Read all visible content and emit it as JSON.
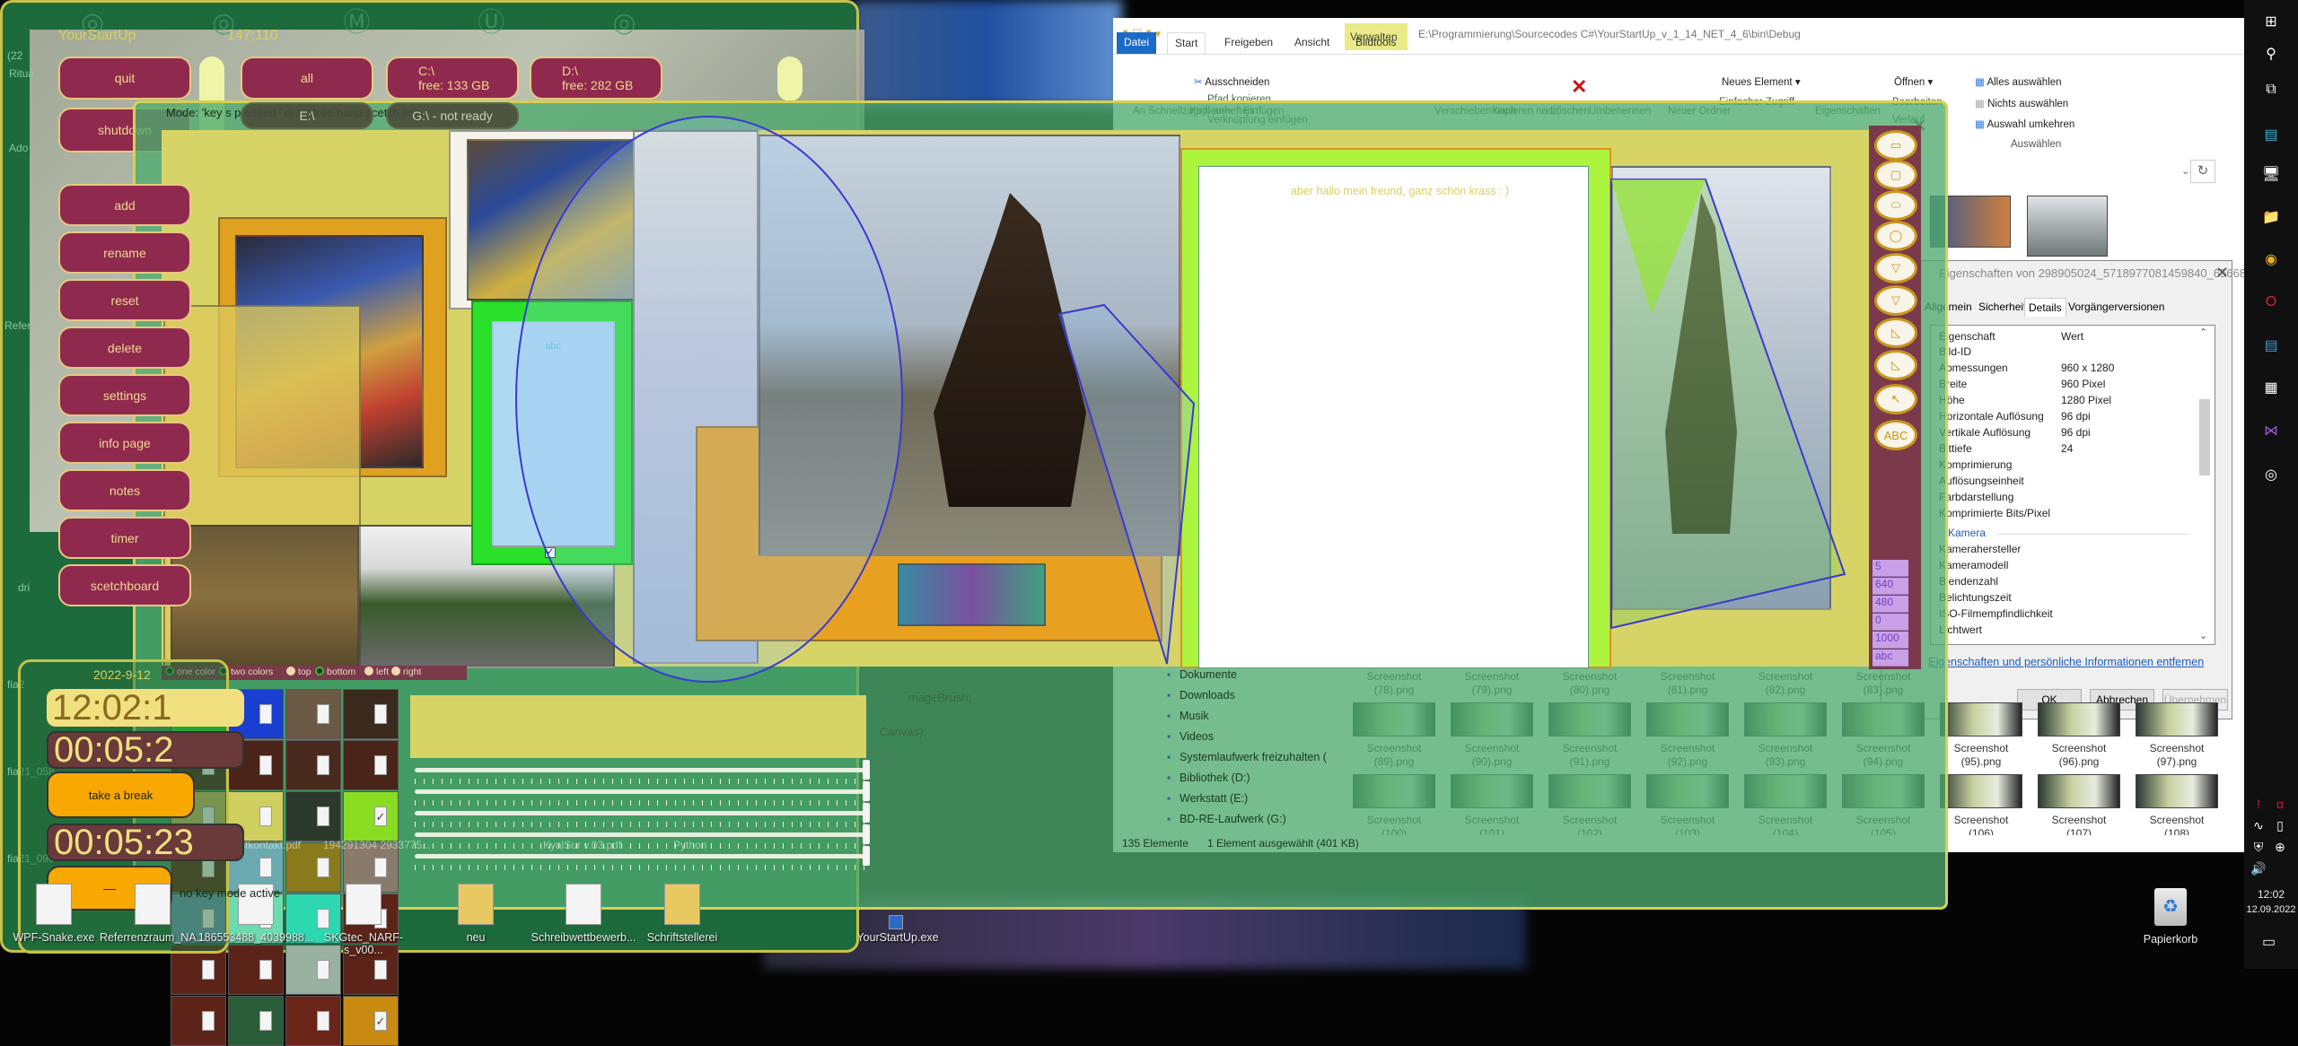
{
  "desktop": {
    "left_labels": [
      "(22",
      "Ritua",
      "Ado",
      "Refer",
      "dri",
      "fia2",
      "fia21_058",
      "fia21_090"
    ],
    "icons": [
      "WPF-Snake.exe",
      "Referrenzraum_NA...",
      "186553488_4039988...",
      "SKGtec_NARF-s_v00...",
      "neu",
      "Schreibwettbewerb...",
      "Schriftstellerei",
      "YourStartUp.exe"
    ],
    "recycle_bin": "Papierkorb",
    "faint_files": [
      "Erstkontakt.pdf",
      "194291304 2933775...",
      "KyalSur v.03.pdf",
      "Python"
    ],
    "code_lines": [
      "mageBrush;",
      "Canvas);"
    ]
  },
  "yourstartup": {
    "title": "YourStartUp",
    "coords": "147;110",
    "top_buttons": [
      {
        "label": "quit"
      },
      {
        "label": "all"
      },
      {
        "label": "C:\\\nfree: 133 GB"
      },
      {
        "label": "D:\\\nfree: 282 GB"
      }
    ],
    "shutdown": "shutdown",
    "hidden_buttons": [
      "E:\\",
      "G:\\ - not ready"
    ],
    "side_buttons": [
      "add",
      "rename",
      "reset",
      "delete",
      "settings",
      "info page",
      "notes",
      "timer",
      "scetchboard"
    ]
  },
  "scetchboard": {
    "mode_text": "Mode: 'key s pressed ' draw free hand scetch line",
    "canvas_text_abc": "abc",
    "note_text": "aber hallo mein freund, ganz schön krass : )",
    "radio_options": [
      {
        "label": "one color",
        "selected": true
      },
      {
        "label": "two colors",
        "selected": true
      },
      {
        "label": "top",
        "selected": false
      },
      {
        "label": "bottom",
        "selected": true
      },
      {
        "label": "left",
        "selected": false
      },
      {
        "label": "right",
        "selected": false
      }
    ],
    "color_grid": [
      [
        {
          "color": "#22dd22",
          "checked": false
        },
        {
          "color": "#1a3fd0",
          "checked": false
        },
        {
          "color": "#6b5a46",
          "checked": false
        },
        {
          "color": "#3a2a1e",
          "checked": false
        }
      ],
      [
        {
          "color": "#4a2a1e",
          "checked": false
        },
        {
          "color": "#4a2418",
          "checked": false
        },
        {
          "color": "#4a2a1e",
          "checked": false
        },
        {
          "color": "#4a2418",
          "checked": false
        }
      ],
      [
        {
          "color": "#c9b860",
          "checked": false
        },
        {
          "color": "#cfcf60",
          "checked": false
        },
        {
          "color": "#2c3a2c",
          "checked": false
        },
        {
          "color": "#88dd22",
          "checked": true
        }
      ],
      [
        {
          "color": "#5c2c18",
          "checked": false
        },
        {
          "color": "#6aaab0",
          "checked": false
        },
        {
          "color": "#8a7a1c",
          "checked": false
        },
        {
          "color": "#8a7a6c",
          "checked": false
        }
      ],
      [
        {
          "color": "#6a9ab8",
          "checked": false
        },
        {
          "color": "#6adcb0",
          "checked": false
        },
        {
          "color": "#2cd8b0",
          "checked": false
        },
        {
          "color": "#5c2418",
          "checked": false
        }
      ],
      [
        {
          "color": "#5c2418",
          "checked": false
        },
        {
          "color": "#5c2418",
          "checked": false
        },
        {
          "color": "#9ab0a0",
          "checked": false
        },
        {
          "color": "#5c2418",
          "checked": false
        }
      ],
      [
        {
          "color": "#5c2418",
          "checked": false
        },
        {
          "color": "#2a5c3a",
          "checked": false
        },
        {
          "color": "#6a2418",
          "checked": false
        },
        {
          "color": "#c88a10",
          "checked": true
        }
      ]
    ],
    "check_glyph": "✓",
    "sliders": [
      1.0,
      1.0,
      1.0,
      1.0,
      1.0
    ],
    "tool_palette": [
      "rectangle",
      "rounded-rectangle",
      "ellipse",
      "ellipse-outline",
      "triangle-down",
      "triangle-down-outline",
      "right-triangle",
      "stacked-triangle",
      "arrow-up-left",
      "text"
    ],
    "tool_text_label": "ABC",
    "param_list": [
      "5",
      "640",
      "480",
      "0",
      "1000",
      "abc"
    ],
    "status": "no key mode active"
  },
  "timer": {
    "date": "2022-9-12",
    "clock": "12:02:1",
    "countdown1": "00:05:2",
    "break_button": "take a break",
    "countdown2": "00:05:23",
    "dash_button": "—"
  },
  "explorer": {
    "path": "E:\\Programmierung\\Sourcecodes C#\\YourStartUp_v_1_14_NET_4_6\\bin\\Debug",
    "context_tab": "Verwalten",
    "tabs": [
      "Datei",
      "Start",
      "Freigeben",
      "Ansicht",
      "Bildtools"
    ],
    "ribbon": {
      "pin": "An Schnellzugriff anheften",
      "copy": "Kopieren",
      "paste": "Einfügen",
      "cut": "Ausschneiden",
      "copy_path": "Pfad kopieren",
      "paste_link": "Verknüpfung einfügen",
      "move_to": "Verschieben nach",
      "copy_to": "Kopieren nach",
      "delete": "Löschen",
      "rename": "Umbenennen",
      "new_folder": "Neuer Ordner",
      "new_item": "Neues Element",
      "easy_access": "Einfacher Zugriff",
      "properties": "Eigenschaften",
      "open": "Öffnen",
      "edit": "Bearbeiten",
      "history": "Verlauf",
      "select_all": "Alles auswählen",
      "select_none": "Nichts auswählen",
      "invert": "Auswahl umkehren",
      "select_group": "Auswählen"
    },
    "nav": [
      "Dokumente",
      "Downloads",
      "Musik",
      "Videos",
      "Systemlaufwerk freizuhalten (",
      "Bibliothek (D:)",
      "Werkstatt (E:)",
      "BD-RE-Laufwerk (G:)"
    ],
    "files_row1": [
      "Screenshot\n(78).png",
      "Screenshot\n(79).png",
      "Screenshot\n(80).png",
      "Screenshot\n(81).png",
      "Screenshot\n(82).png",
      "Screenshot\n(83).png"
    ],
    "files_row2": [
      "Screenshot\n(89).png",
      "Screenshot\n(90).png",
      "Screenshot\n(91).png",
      "Screenshot\n(92).png",
      "Screenshot\n(93).png",
      "Screenshot\n(94).png",
      "Screenshot\n(95).png",
      "Screenshot\n(96).png",
      "Screenshot\n(97).png"
    ],
    "files_row3": [
      "Screenshot\n(100)",
      "Screenshot\n(101)",
      "Screenshot\n(102)",
      "Screenshot\n(103)",
      "Screenshot\n(104)",
      "Screenshot\n(105)",
      "Screenshot\n(106)",
      "Screenshot\n(107)",
      "Screenshot\n(108)"
    ],
    "status_count": "135 Elemente",
    "status_selected": "1 Element ausgewählt (401 KB)"
  },
  "properties": {
    "title": "Eigenschaften von 298905024_5718977081459840_65668...",
    "tabs": [
      "Allgemein",
      "Sicherheit",
      "Details",
      "Vorgängerversionen"
    ],
    "active_tab": "Details",
    "col_property": "Eigenschaft",
    "col_value": "Wert",
    "rows": [
      {
        "k": "Bild-ID",
        "v": ""
      },
      {
        "k": "Abmessungen",
        "v": "960 x 1280"
      },
      {
        "k": "Breite",
        "v": "960 Pixel"
      },
      {
        "k": "Höhe",
        "v": "1280 Pixel"
      },
      {
        "k": "Horizontale Auflösung",
        "v": "96 dpi"
      },
      {
        "k": "Vertikale Auflösung",
        "v": "96 dpi"
      },
      {
        "k": "Bittiefe",
        "v": "24"
      },
      {
        "k": "Komprimierung",
        "v": ""
      },
      {
        "k": "Auflösungseinheit",
        "v": ""
      },
      {
        "k": "Farbdarstellung",
        "v": ""
      },
      {
        "k": "Komprimierte Bits/Pixel",
        "v": ""
      }
    ],
    "section": "Kamera",
    "camera_rows": [
      "Kamerahersteller",
      "Kameramodell",
      "Blendenzahl",
      "Belichtungszeit",
      "ISO-Filmempfindlichkeit",
      "Lichtwert"
    ],
    "link": "Eigenschaften und persönliche Informationen entfernen",
    "ok": "OK",
    "cancel": "Abbrechen",
    "apply": "Übernehmen"
  },
  "taskbar": {
    "icons": [
      "windows-start",
      "search",
      "task-view",
      "cloud-app",
      "remote-desktop",
      "file-explorer",
      "chrome",
      "opera",
      "libreoffice-writer",
      "office-app",
      "visual-studio",
      "terminal-app"
    ],
    "tray_icons": [
      "amd-alert",
      "avira",
      "audio-app",
      "usb",
      "security",
      "network",
      "volume"
    ],
    "time": "12:02",
    "date": "12.09.2022"
  }
}
